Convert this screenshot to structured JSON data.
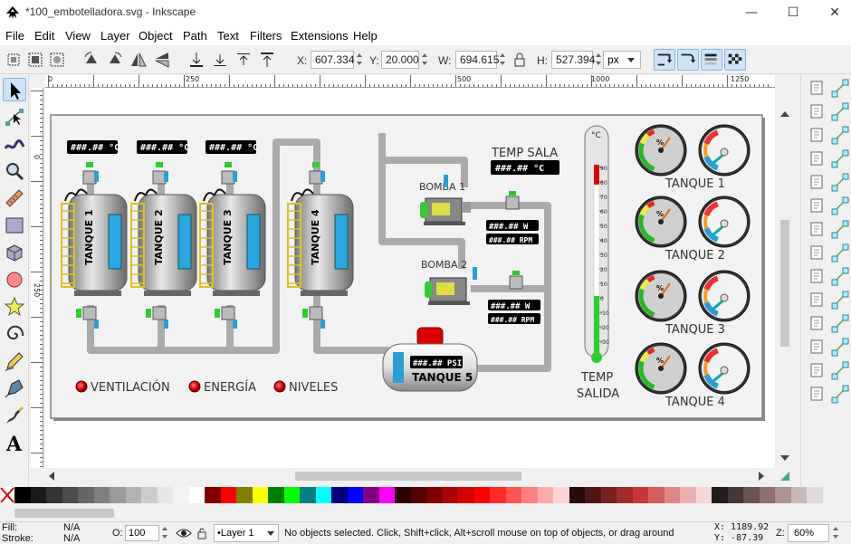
{
  "window": {
    "title": "*100_embotelladora.svg - Inkscape",
    "buttons": [
      "minimize",
      "maximize",
      "close"
    ]
  },
  "menu": {
    "items": [
      {
        "label": "File",
        "key": "F"
      },
      {
        "label": "Edit",
        "key": "E"
      },
      {
        "label": "View",
        "key": "V"
      },
      {
        "label": "Layer",
        "key": "L"
      },
      {
        "label": "Object",
        "key": "O"
      },
      {
        "label": "Path",
        "key": "P"
      },
      {
        "label": "Text",
        "key": "T"
      },
      {
        "label": "Filters",
        "key": "r"
      },
      {
        "label": "Extensions",
        "key": "x"
      },
      {
        "label": "Help",
        "key": "H"
      }
    ]
  },
  "controls": {
    "x_label": "X:",
    "x_value": "607.334",
    "y_label": "Y:",
    "y_value": "20.000",
    "w_label": "W:",
    "w_value": "694.615",
    "h_label": "H:",
    "h_value": "527.394",
    "unit": "px"
  },
  "ruler": {
    "h_labels": [
      "0",
      "250",
      "500",
      "750",
      "1000",
      "1250"
    ],
    "v_labels": [
      "0",
      "250"
    ]
  },
  "drawing": {
    "lcd_temp": "###.##  °C",
    "lcd_watts": "###.## W",
    "lcd_rpm": "###.## RPM",
    "lcd_psi": "###.##  PSI",
    "lcd_temp_sala": "###.##  °C",
    "tanks": [
      "TANQUE 1",
      "TANQUE 2",
      "TANQUE 3",
      "TANQUE 4"
    ],
    "tank5": "TANQUE 5",
    "pump1": "BOMBA 1",
    "pump2": "BOMBA 2",
    "temp_sala": "TEMP SALA",
    "temp_salida_1": "TEMP",
    "temp_salida_2": "SALIDA",
    "thermo_unit": "°C",
    "thermo_ticks": [
      "90",
      "80",
      "70",
      "60",
      "50",
      "40",
      "30",
      "20",
      "10",
      "0",
      "-10",
      "-20",
      "-30"
    ],
    "indicators": [
      "VENTILACIÓN",
      "ENERGÍA",
      "NIVELES"
    ],
    "gauge_labels": [
      "TANQUE 1",
      "TANQUE 2",
      "TANQUE 3",
      "TANQUE 4"
    ],
    "gauge_unit": "%"
  },
  "palette": {
    "colors": [
      "#000000",
      "#1a1a1a",
      "#333333",
      "#4d4d4d",
      "#666666",
      "#808080",
      "#999999",
      "#b3b3b3",
      "#cccccc",
      "#e6e6e6",
      "#f2f2f2",
      "#ffffff",
      "#800000",
      "#ff0000",
      "#808000",
      "#ffff00",
      "#008000",
      "#00ff00",
      "#008080",
      "#00ffff",
      "#000080",
      "#0000ff",
      "#800080",
      "#ff00ff",
      "#2b0000",
      "#550000",
      "#800000",
      "#aa0000",
      "#d40000",
      "#ff0000",
      "#ff2a2a",
      "#ff5555",
      "#ff8080",
      "#ffaaaa",
      "#ffd5d5",
      "#280b0b",
      "#501616",
      "#782121",
      "#a02c2c",
      "#c83737",
      "#d35f5f",
      "#de8787",
      "#e9afaf",
      "#f4d7d7",
      "#241c1c",
      "#483737",
      "#6c5353",
      "#916f6f",
      "#ac9393",
      "#c8b7b7",
      "#e3dbdb"
    ]
  },
  "status": {
    "fill_label": "Fill:",
    "fill_value": "N/A",
    "stroke_label": "Stroke:",
    "stroke_value": "N/A",
    "opacity_label": "O:",
    "opacity_value": "100",
    "layer": "•Layer 1",
    "message": "No objects selected. Click, Shift+click, Alt+scroll mouse on top of objects, or drag around",
    "x_coord": "X: 1189.92",
    "y_coord": "Y:   -87.39",
    "zoom_label": "Z:",
    "zoom_value": "60%"
  }
}
